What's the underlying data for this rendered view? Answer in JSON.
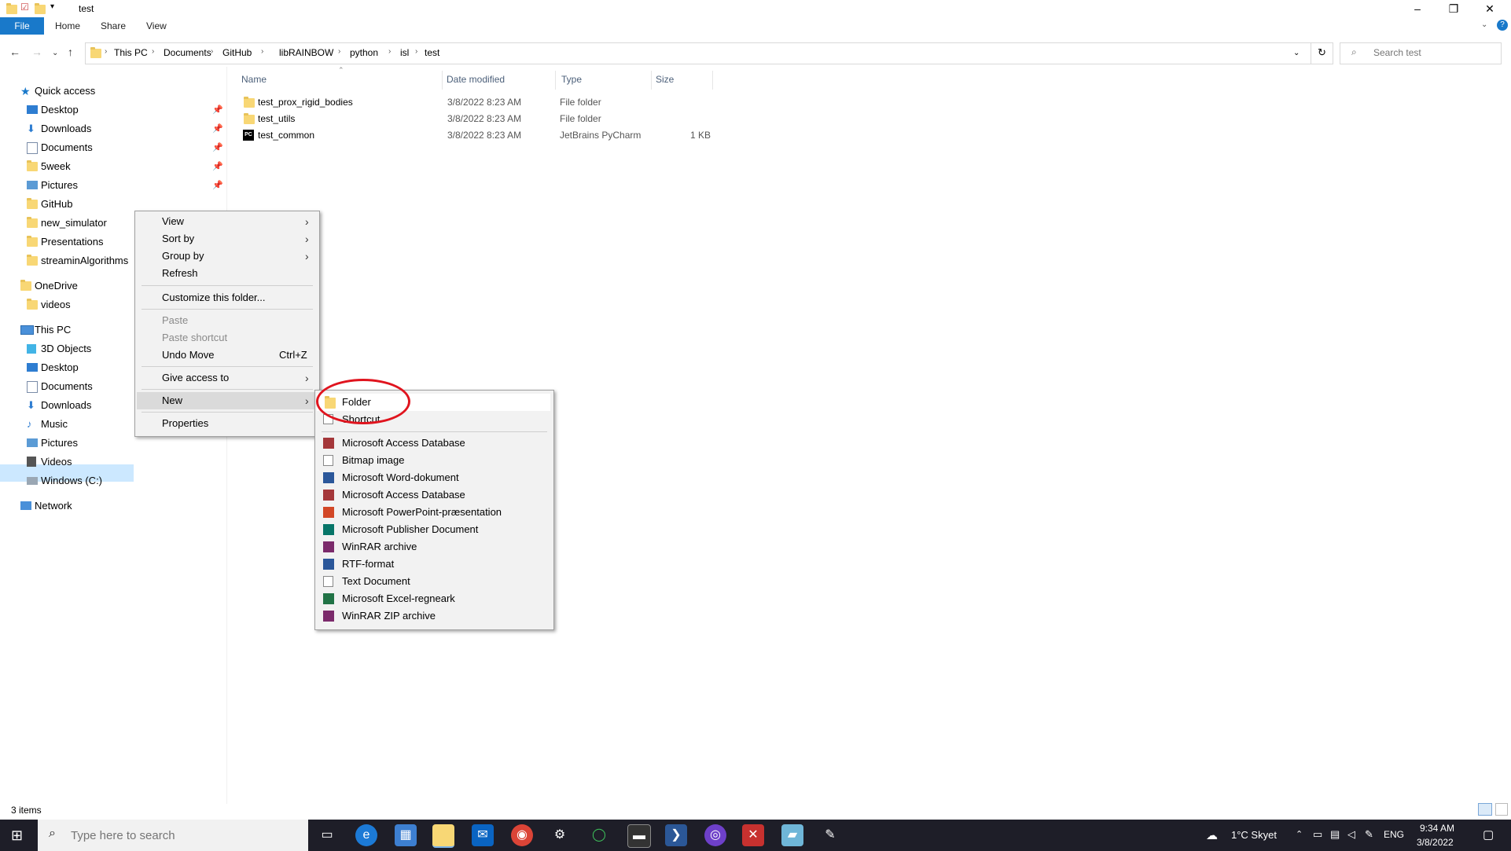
{
  "window": {
    "title": "test",
    "controls": {
      "minimize": "–",
      "restore": "❐",
      "close": "✕"
    }
  },
  "ribbon": {
    "tabs": [
      "File",
      "Home",
      "Share",
      "View"
    ]
  },
  "address": {
    "crumbs": [
      "This PC",
      "Documents",
      "GitHub",
      "libRAINBOW",
      "python",
      "isl",
      "test"
    ]
  },
  "search": {
    "placeholder": "Search test"
  },
  "nav": {
    "quick_access": "Quick access",
    "quick_items": [
      "Desktop",
      "Downloads",
      "Documents",
      "5week",
      "Pictures",
      "GitHub",
      "new_simulator",
      "Presentations",
      "streaminAlgorithms"
    ],
    "onedrive": "OneDrive",
    "onedrive_items": [
      "videos"
    ],
    "this_pc": "This PC",
    "pc_items": [
      "3D Objects",
      "Desktop",
      "Documents",
      "Downloads",
      "Music",
      "Pictures",
      "Videos",
      "Windows (C:)"
    ],
    "network": "Network"
  },
  "columns": {
    "name": "Name",
    "date": "Date modified",
    "type": "Type",
    "size": "Size"
  },
  "files": [
    {
      "name": "test_prox_rigid_bodies",
      "date": "3/8/2022 8:23 AM",
      "type": "File folder",
      "size": ""
    },
    {
      "name": "test_utils",
      "date": "3/8/2022 8:23 AM",
      "type": "File folder",
      "size": ""
    },
    {
      "name": "test_common",
      "date": "3/8/2022 8:23 AM",
      "type": "JetBrains PyCharm",
      "size": "1 KB"
    }
  ],
  "context_menu": {
    "view": "View",
    "sort_by": "Sort by",
    "group_by": "Group by",
    "refresh": "Refresh",
    "customize": "Customize this folder...",
    "paste": "Paste",
    "paste_shortcut": "Paste shortcut",
    "undo_move": "Undo Move",
    "undo_shortcut": "Ctrl+Z",
    "give_access": "Give access to",
    "new": "New",
    "properties": "Properties"
  },
  "new_menu": {
    "folder": "Folder",
    "shortcut": "Shortcut",
    "items": [
      "Microsoft Access Database",
      "Bitmap image",
      "Microsoft Word-dokument",
      "Microsoft Access Database",
      "Microsoft PowerPoint-præsentation",
      "Microsoft Publisher Document",
      "WinRAR archive",
      "RTF-format",
      "Text Document",
      "Microsoft Excel-regneark",
      "WinRAR ZIP archive"
    ]
  },
  "status": {
    "items": "3 items"
  },
  "taskbar": {
    "search_placeholder": "Type here to search",
    "weather": "1°C  Skyet",
    "lang": "ENG",
    "time": "9:34 AM",
    "date": "3/8/2022"
  }
}
